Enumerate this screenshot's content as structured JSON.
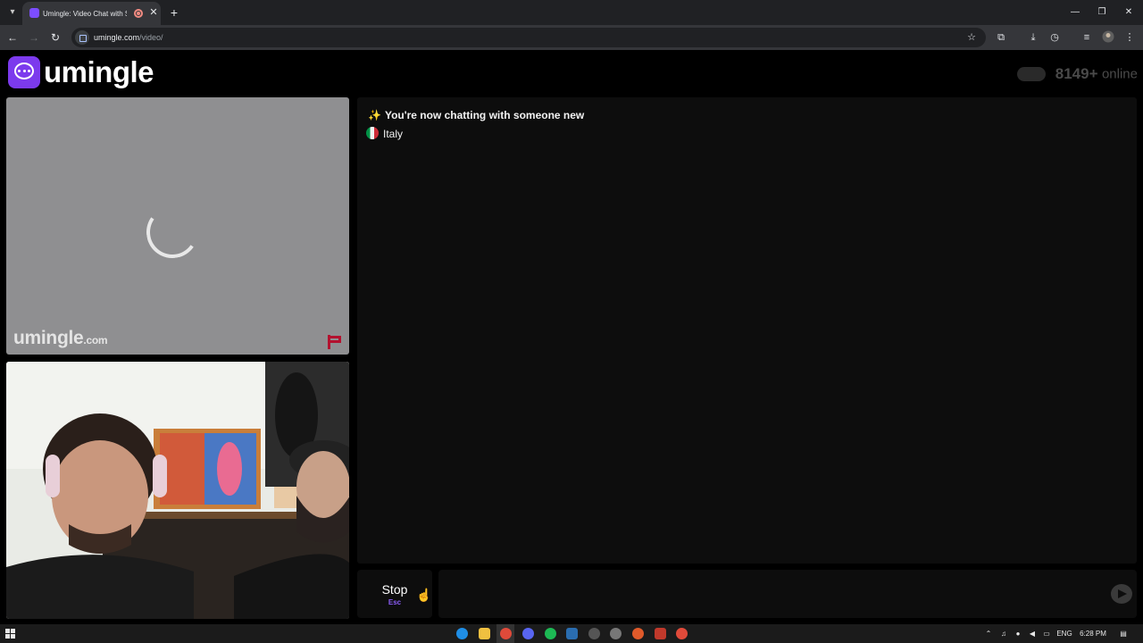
{
  "browser": {
    "tab_title": "Umingle: Video Chat with S",
    "tab_close": "✕",
    "new_tab": "+",
    "url_domain": "umingle.com",
    "url_path": "/video/",
    "icons": [
      "tab-search-icon",
      "umingle-favicon",
      "recording-icon",
      "close-icon",
      "plus-icon",
      "back-arrow-icon",
      "forward-arrow-icon",
      "reload-icon",
      "site-info-icon",
      "star-icon",
      "extensions-icon",
      "download-icon",
      "history-icon",
      "media-control-icon",
      "profile-avatar-icon",
      "kebab-menu-icon",
      "minimize-icon",
      "restore-icon",
      "close-window-icon"
    ]
  },
  "header": {
    "logo_text": "umingle",
    "online_count": "8149+",
    "online_label": "online"
  },
  "stranger_video": {
    "watermark": "umingle",
    "watermark_suffix": ".com",
    "state": "loading"
  },
  "chat": {
    "message": "You're now chatting with someone new",
    "sparkle": "✨",
    "country": "Italy"
  },
  "controls": {
    "stop_label": "Stop",
    "stop_hint": "Esc",
    "message_placeholder": ""
  },
  "taskbar": {
    "language": "ENG",
    "time": "6:28 PM"
  },
  "colors": {
    "brand": "#7c3aed",
    "report": "#b3122f",
    "page_bg": "#000000",
    "panel_bg": "#0d0d0d"
  }
}
